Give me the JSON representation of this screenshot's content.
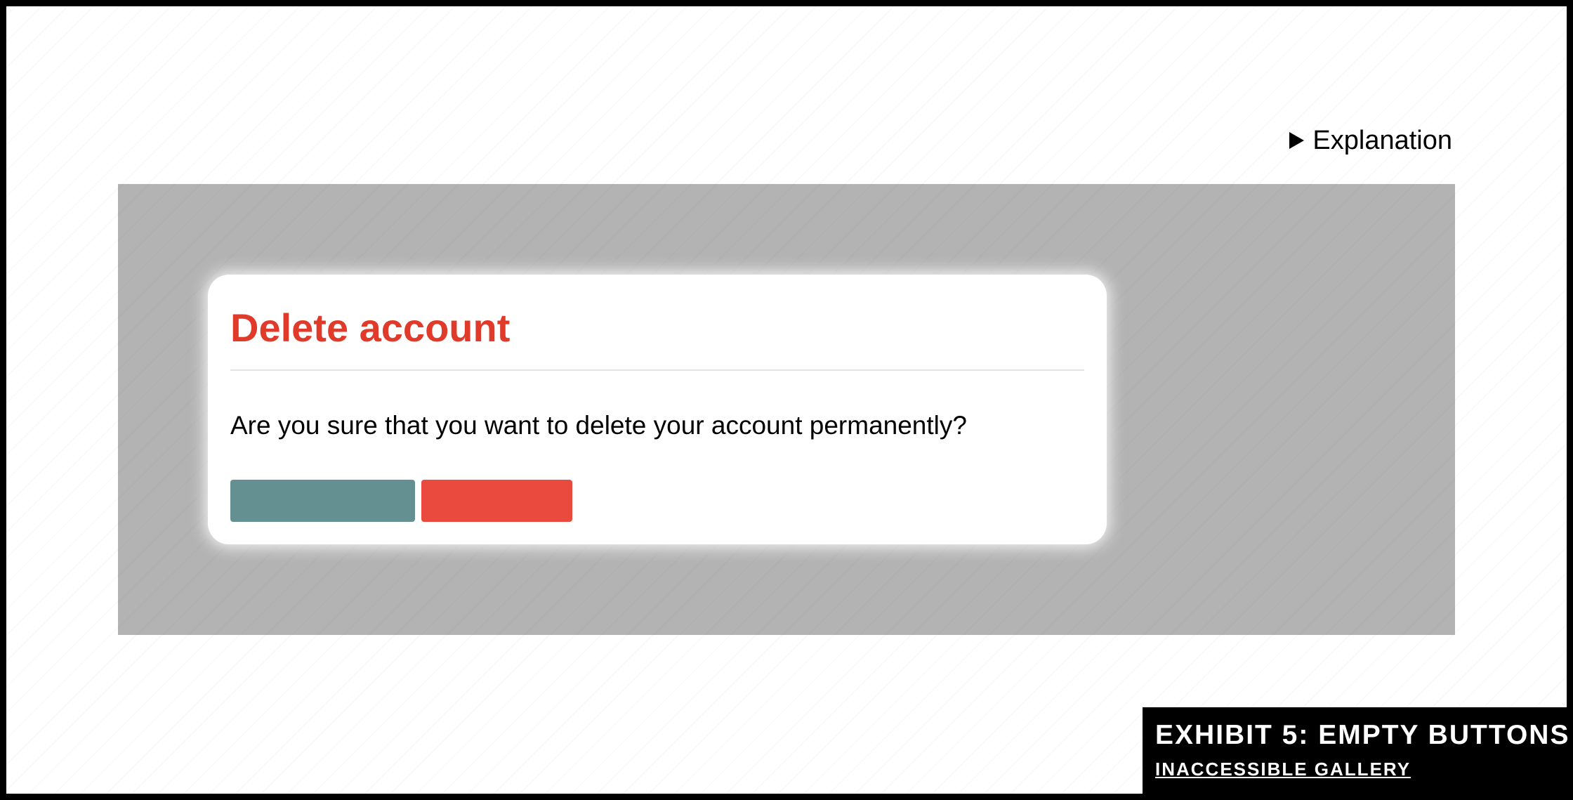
{
  "explanation": {
    "label": "Explanation",
    "icon": "triangle-right-icon"
  },
  "dialog": {
    "title": "Delete account",
    "message": "Are you sure that you want to delete your account permanently?",
    "cancel_button_label": "",
    "delete_button_label": "",
    "colors": {
      "title": "#e03a2a",
      "cancel_button": "#659091",
      "delete_button": "#ea4a3d"
    }
  },
  "caption": {
    "title": "EXHIBIT 5: EMPTY BUTTONS",
    "link": "INACCESSIBLE GALLERY"
  }
}
